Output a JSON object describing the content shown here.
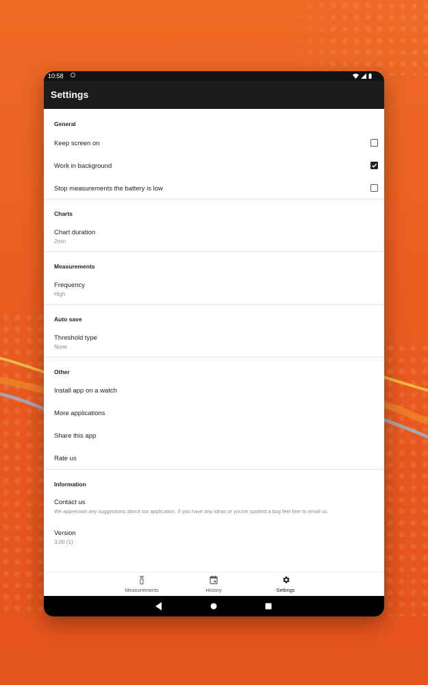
{
  "status_bar": {
    "time": "10:58"
  },
  "app_bar": {
    "title": "Settings"
  },
  "sections": {
    "general": {
      "title": "General",
      "keep_screen_on": {
        "label": "Keep screen on",
        "checked": false
      },
      "work_in_background": {
        "label": "Work in background",
        "checked": true
      },
      "stop_battery_low": {
        "label": "Stop measurements the battery is low",
        "checked": false
      }
    },
    "charts": {
      "title": "Charts",
      "chart_duration": {
        "label": "Chart duration",
        "value": "2min"
      }
    },
    "measurements": {
      "title": "Measurements",
      "frequency": {
        "label": "Frequency",
        "value": "High"
      }
    },
    "auto_save": {
      "title": "Auto save",
      "threshold_type": {
        "label": "Threshold type",
        "value": "None"
      }
    },
    "other": {
      "title": "Other",
      "install_watch": {
        "label": "Install app on a watch"
      },
      "more_apps": {
        "label": "More applications"
      },
      "share_app": {
        "label": "Share this app"
      },
      "rate_us": {
        "label": "Rate us"
      }
    },
    "information": {
      "title": "Information",
      "contact_us": {
        "label": "Contact us",
        "description": "We appreciate any suggestions about our application. If you have any ideas or you've spotted a bug feel free to email us."
      },
      "version": {
        "label": "Version",
        "value": "3.00 (1)"
      }
    }
  },
  "bottom_nav": {
    "measurements": {
      "label": "Measurements",
      "icon": "sensor-icon"
    },
    "history": {
      "label": "History",
      "icon": "calendar-icon"
    },
    "settings": {
      "label": "Settings",
      "icon": "gear-icon",
      "active": true
    }
  },
  "colors": {
    "background_orange": "#ee6a25",
    "app_bar": "#1c1c1c",
    "status_bar": "#111111",
    "system_nav": "#000000"
  }
}
